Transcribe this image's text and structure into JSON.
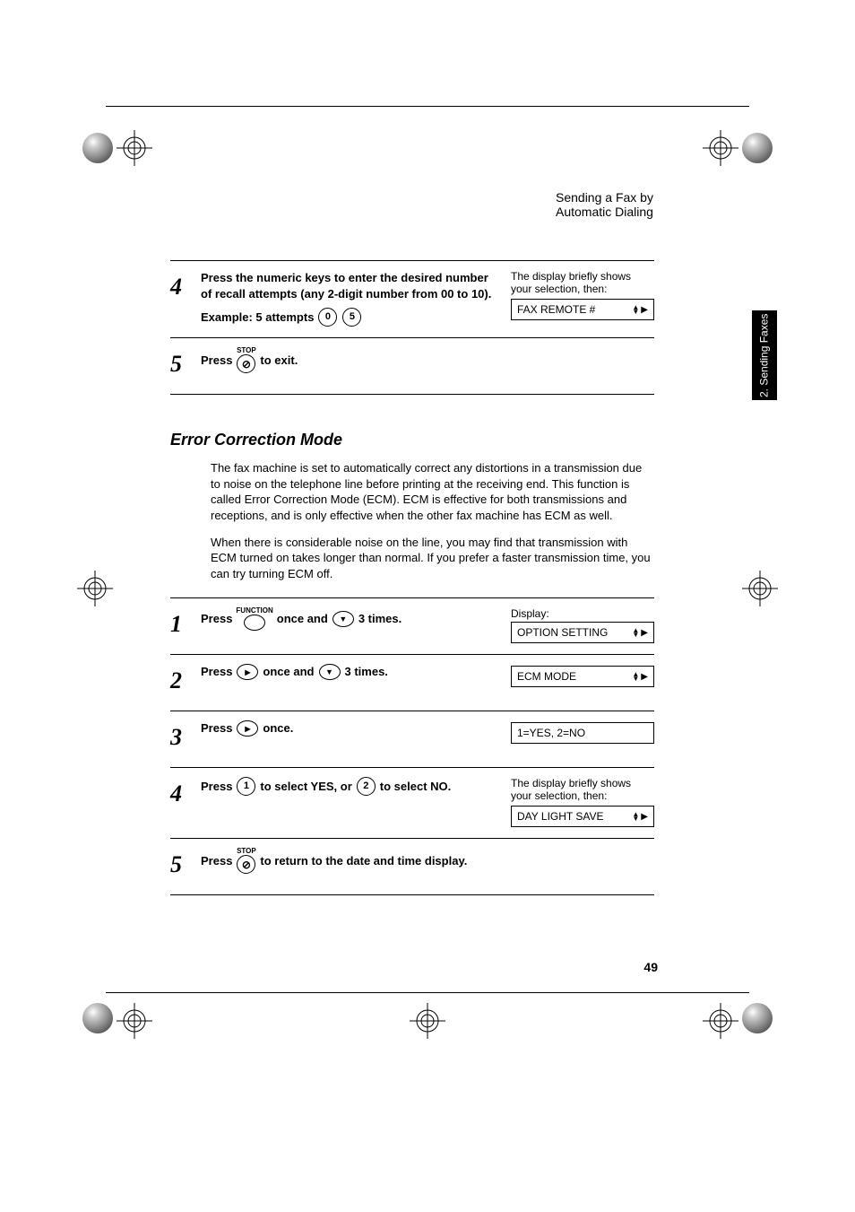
{
  "header": {
    "running_title": "Sending a Fax by Automatic Dialing"
  },
  "side_tab": {
    "label": "2. Sending\nFaxes"
  },
  "top_steps": [
    {
      "num": "4",
      "text_1": "Press the numeric keys to enter the desired number of recall attempts (any 2-digit number from 00 to 10).",
      "text_2": "Example: 5 attempts",
      "keys": [
        "0",
        "5"
      ],
      "result_note": "The display briefly shows your selection, then:",
      "display": "FAX REMOTE #"
    },
    {
      "num": "5",
      "text_1": "Press",
      "key_label": "STOP",
      "text_2": "to exit."
    }
  ],
  "section": {
    "title": "Error Correction Mode",
    "para_1": "The fax machine is set to automatically correct any distortions in a transmission due to noise on the telephone line before printing at the receiving end. This function is called Error Correction Mode (ECM). ECM is effective for both transmissions and receptions, and is only effective when the other fax machine has ECM as well.",
    "para_2": "When there is considerable noise on the line, you may find that transmission with ECM turned on takes longer than normal. If you prefer a faster transmission time, you can try turning ECM off."
  },
  "steps": [
    {
      "num": "1",
      "pre": "Press",
      "key_label": "FUNCTION",
      "mid": "once and",
      "post": "3 times.",
      "result_label": "Display:",
      "display": "OPTION SETTING"
    },
    {
      "num": "2",
      "pre": "Press",
      "mid": "once and",
      "post": "3 times.",
      "display": "ECM MODE"
    },
    {
      "num": "3",
      "pre": "Press",
      "post": "once.",
      "display": "1=YES, 2=NO"
    },
    {
      "num": "4",
      "pre": "Press",
      "key1": "1",
      "mid": "to select YES, or",
      "key2": "2",
      "post": "to select NO.",
      "result_note": "The display briefly shows your selection, then:",
      "display": "DAY LIGHT SAVE"
    },
    {
      "num": "5",
      "pre": "Press",
      "key_label": "STOP",
      "post": "to return to the date and time display."
    }
  ],
  "page_number": "49"
}
